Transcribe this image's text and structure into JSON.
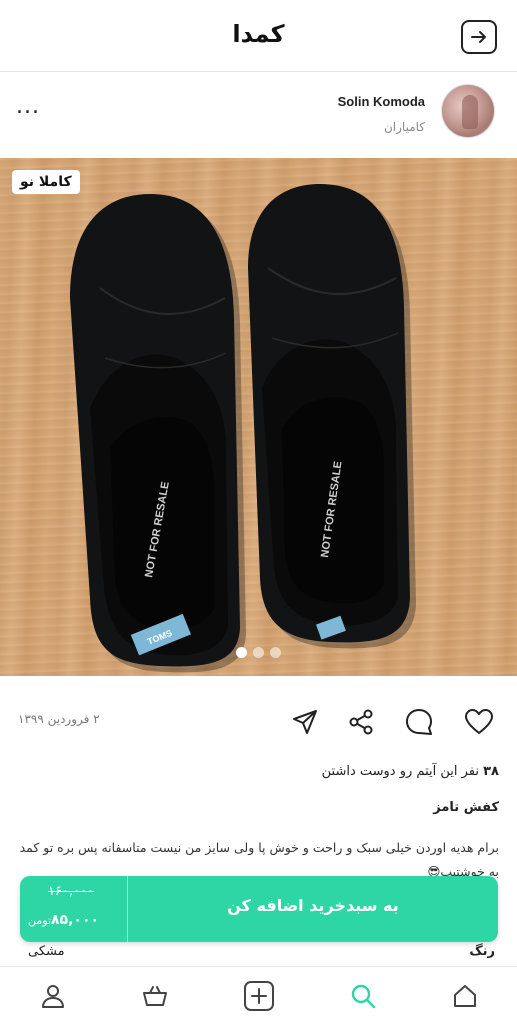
{
  "header": {
    "logo": "کمدا",
    "back_icon": "arrow-right-box-icon"
  },
  "seller": {
    "name": "Solin Komoda",
    "city": "کامیاران",
    "more_label": "..."
  },
  "product_image": {
    "badge": "کاملا نو",
    "slide_count": 3,
    "active_slide": 1,
    "brand_tag": "TOMS",
    "insole_text": "NOT FOR RESALE"
  },
  "actions": {
    "date": "۲ فروردین ۱۳۹۹",
    "icons": [
      "heart-icon",
      "comment-icon",
      "share-icon",
      "send-icon"
    ]
  },
  "likes": {
    "count": "۳۸",
    "text": "نفر این آیتم رو دوست داشتن"
  },
  "product": {
    "title": "کفش تامز",
    "description": "برام هدیه اوردن خیلی سبک و راحت و خوش پا ولی سایز من نیست متاسفانه پس بره تو کمد به خوشتیپ😎"
  },
  "cart": {
    "old_price": "۱۶۰,۰۰۰",
    "new_price": "۸۵,۰۰۰",
    "currency": "تومن",
    "add_label": "به سبدخرید اضافه کن"
  },
  "attributes": {
    "color_label": "رنگ",
    "color_value": "مشکی"
  },
  "bottom_nav": {
    "items": [
      "home-icon",
      "search-icon",
      "add-icon",
      "basket-icon",
      "profile-icon"
    ],
    "active": "search-icon"
  },
  "colors": {
    "accent": "#2fd6a5",
    "text": "#222222",
    "muted": "#888888"
  }
}
